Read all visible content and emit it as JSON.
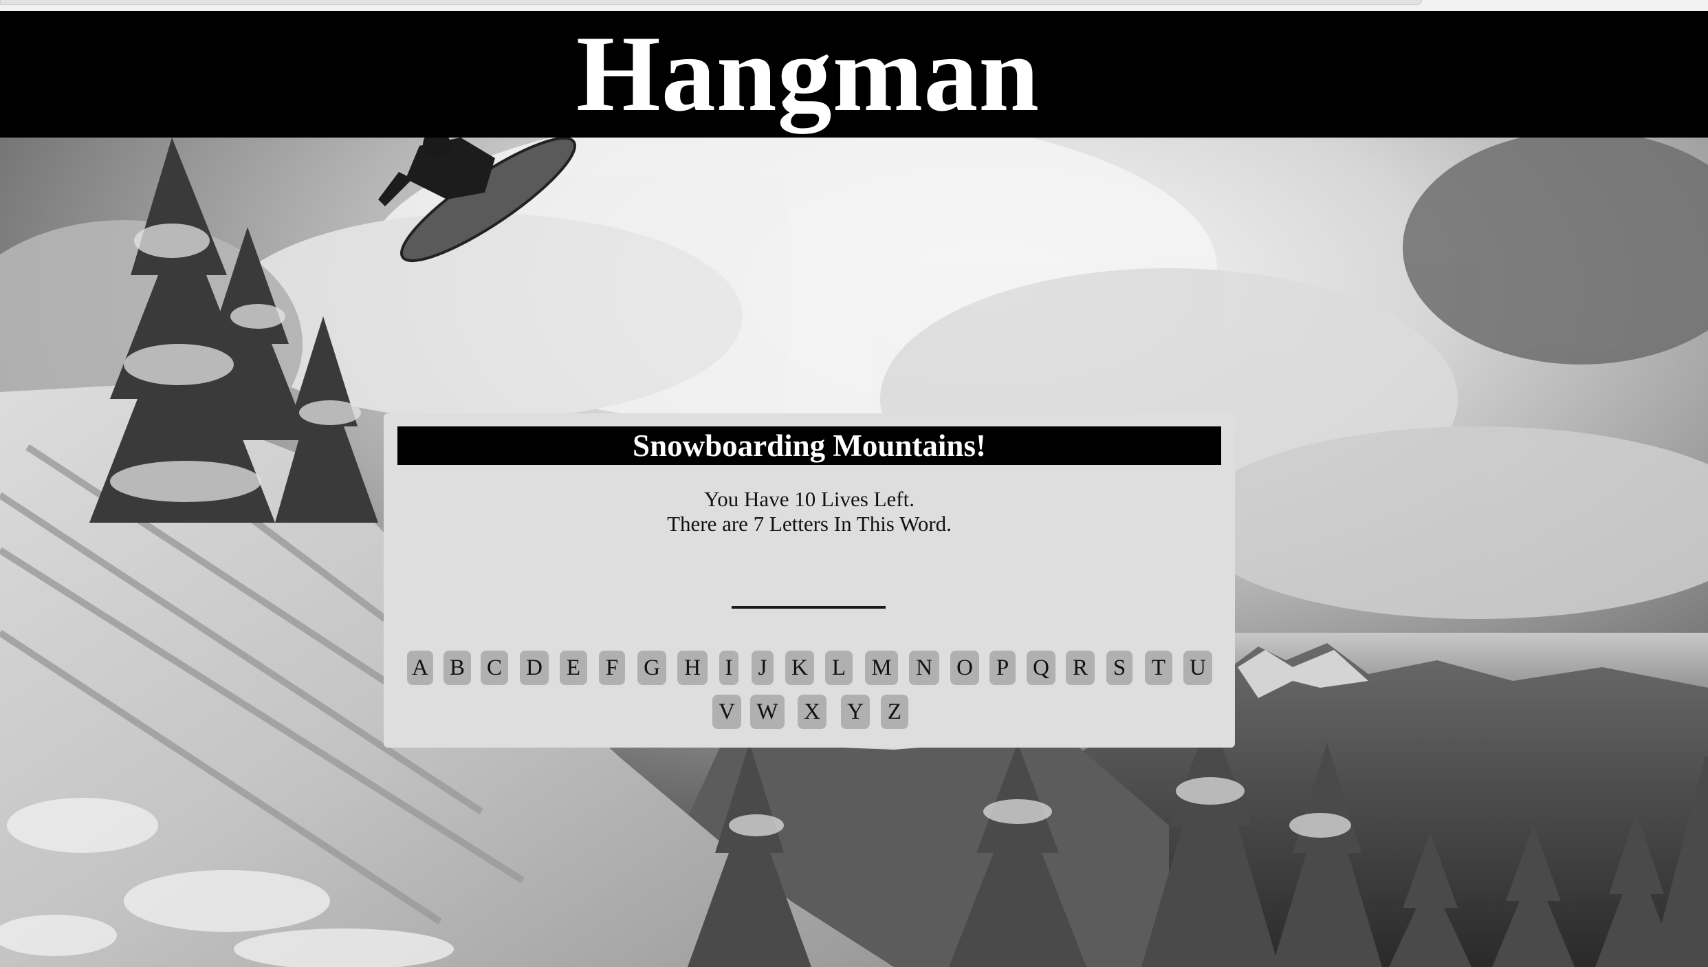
{
  "header": {
    "title": "Hangman"
  },
  "game": {
    "category": "Snowboarding Mountains!",
    "lives_text": "You Have 10 Lives Left.",
    "letters_text": "There are 7 Letters In This Word."
  },
  "keyboard": {
    "letters": [
      "A",
      "B",
      "C",
      "D",
      "E",
      "F",
      "G",
      "H",
      "I",
      "J",
      "K",
      "L",
      "M",
      "N",
      "O",
      "P",
      "Q",
      "R",
      "S",
      "T",
      "U",
      "V",
      "W",
      "X",
      "Y",
      "Z"
    ]
  },
  "colors": {
    "header_background": "#000000",
    "panel_background": "#dedede",
    "letter_button": "#b0b0b0"
  }
}
